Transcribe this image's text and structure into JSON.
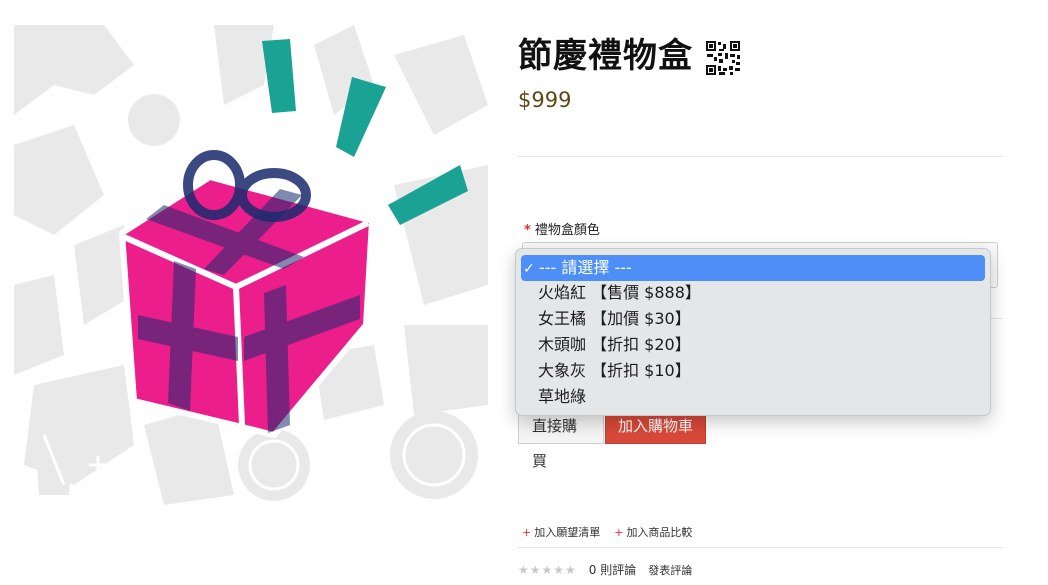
{
  "product": {
    "title": "節慶禮物盒",
    "price": "$999"
  },
  "option": {
    "required_mark": "*",
    "label": "禮物盒顏色",
    "items": [
      {
        "label": "--- 請選擇 ---",
        "selected": true
      },
      {
        "label": "火焰紅 【售價 $888】"
      },
      {
        "label": "女王橘 【加價 $30】"
      },
      {
        "label": "木頭咖 【折扣 $20】"
      },
      {
        "label": "大象灰 【折扣 $10】"
      },
      {
        "label": "草地綠"
      }
    ],
    "check_mark": "✓"
  },
  "actions": {
    "buy_now": "直接購買",
    "add_to_cart": "加入購物車"
  },
  "links": {
    "plus": "+",
    "wishlist": "加入願望清單",
    "compare": "加入商品比較"
  },
  "reviews": {
    "stars": "★★★★★",
    "count": "0 則評論",
    "write": "發表評論"
  },
  "colors": {
    "gift_pink": "#ec1e8c",
    "ribbon_navy": "#1a2a6e",
    "confetti_teal": "#1aa394",
    "cart_button": "#d9493a",
    "selected_highlight": "#4d8ff7"
  },
  "icons": [
    "qr-code-icon",
    "check-icon",
    "star-icon",
    "plus-icon"
  ]
}
